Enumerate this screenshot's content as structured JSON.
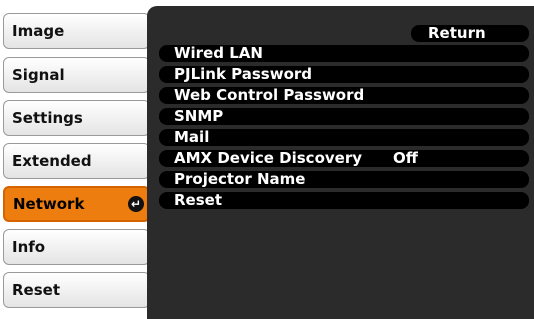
{
  "menu": {
    "items": [
      {
        "label": "Image"
      },
      {
        "label": "Signal"
      },
      {
        "label": "Settings"
      },
      {
        "label": "Extended"
      },
      {
        "label": "Network"
      },
      {
        "label": "Info"
      },
      {
        "label": "Reset"
      }
    ],
    "active_index": 4,
    "enter_icon": "enter-arrow-icon"
  },
  "panel": {
    "return_label": "Return",
    "items": [
      {
        "label": "Wired LAN",
        "value": ""
      },
      {
        "label": "PJLink Password",
        "value": ""
      },
      {
        "label": "Web Control Password",
        "value": ""
      },
      {
        "label": "SNMP",
        "value": ""
      },
      {
        "label": "Mail",
        "value": ""
      },
      {
        "label": "AMX Device Discovery",
        "value": "Off"
      },
      {
        "label": "Projector Name",
        "value": ""
      },
      {
        "label": "Reset",
        "value": ""
      }
    ]
  },
  "colors": {
    "active": "#ee7d10",
    "panel": "#2b2b2b",
    "bar": "#000000"
  }
}
